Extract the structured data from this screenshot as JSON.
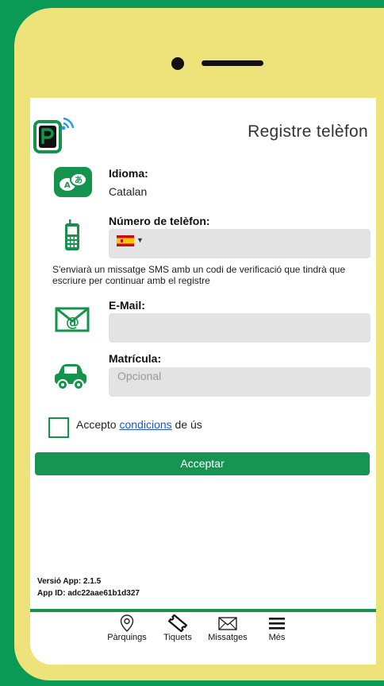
{
  "app": {
    "title": "Registre telèfon",
    "accent_color": "#15934d",
    "frame_color": "#ede37a",
    "background_color": "#0b9a55"
  },
  "language": {
    "label": "Idioma:",
    "value": "Catalan",
    "icon": "translate-icon"
  },
  "phone": {
    "label": "Número de telèfon:",
    "country": "ES",
    "icon": "mobile-phone-icon",
    "value": ""
  },
  "sms_note": "S'enviarà un missatge SMS amb un codi de verificació que tindrà que escriure per continuar amb el registre",
  "email": {
    "label": "E-Mail:",
    "value": "",
    "icon": "envelope-at-icon"
  },
  "plate": {
    "label": "Matrícula:",
    "placeholder": "Opcional",
    "icon": "car-icon"
  },
  "terms": {
    "prefix": "Accepto",
    "link": "condicions",
    "suffix": "de ús",
    "checked": false
  },
  "accept_button": "Acceptar",
  "version": {
    "app_version": "Versió App: 2.1.5",
    "app_id": "App ID: adc22aae61b1d327"
  },
  "nav": [
    {
      "label": "Pàrquings",
      "icon": "map-pin-icon"
    },
    {
      "label": "Tiquets",
      "icon": "ticket-icon"
    },
    {
      "label": "Missatges",
      "icon": "envelope-icon"
    },
    {
      "label": "Més",
      "icon": "menu-icon"
    }
  ]
}
